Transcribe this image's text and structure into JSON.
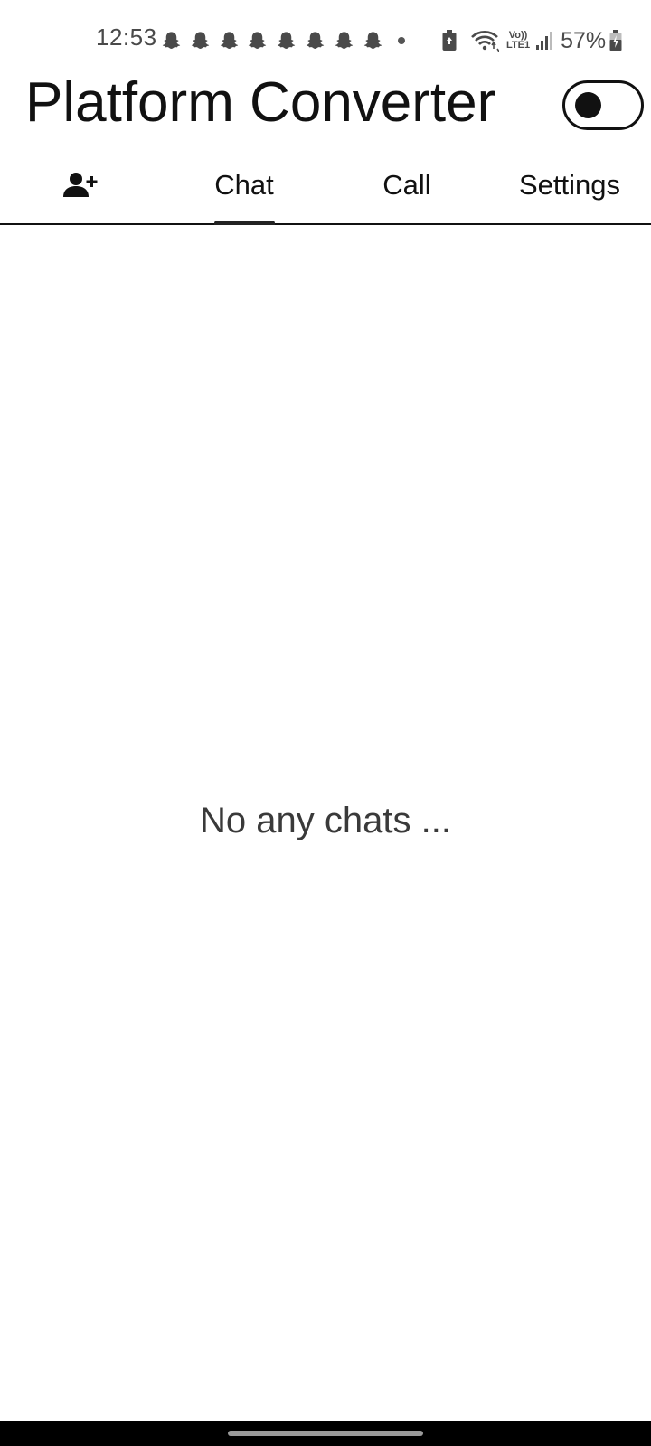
{
  "status_bar": {
    "time": "12:53",
    "battery_percent": "57%",
    "notification_icons": [
      "snapchat-ghost-icon",
      "snapchat-ghost-icon",
      "snapchat-ghost-icon",
      "snapchat-ghost-icon",
      "snapchat-ghost-icon",
      "snapchat-ghost-icon",
      "snapchat-ghost-icon",
      "snapchat-ghost-icon",
      "more-dot-icon"
    ],
    "system_icons": [
      "battery-saver-icon",
      "wifi-icon",
      "volte-icon",
      "signal-icon",
      "battery-charging-icon"
    ],
    "volte_label_top": "Vo))",
    "volte_label_bottom": "LTE1"
  },
  "app_bar": {
    "title": "Platform Converter",
    "theme_toggle": {
      "on": false
    }
  },
  "tabs": {
    "add_contact_icon": "person-add-icon",
    "items": [
      {
        "label": "Chat",
        "selected": true
      },
      {
        "label": "Call",
        "selected": false
      },
      {
        "label": "Settings",
        "selected": false
      }
    ]
  },
  "content": {
    "empty_message": "No any chats ..."
  },
  "colors": {
    "text": "#111111",
    "muted_text": "#4a4a4a",
    "empty_text": "#3a3a3a",
    "nav_bar": "#000000",
    "background": "#ffffff"
  }
}
